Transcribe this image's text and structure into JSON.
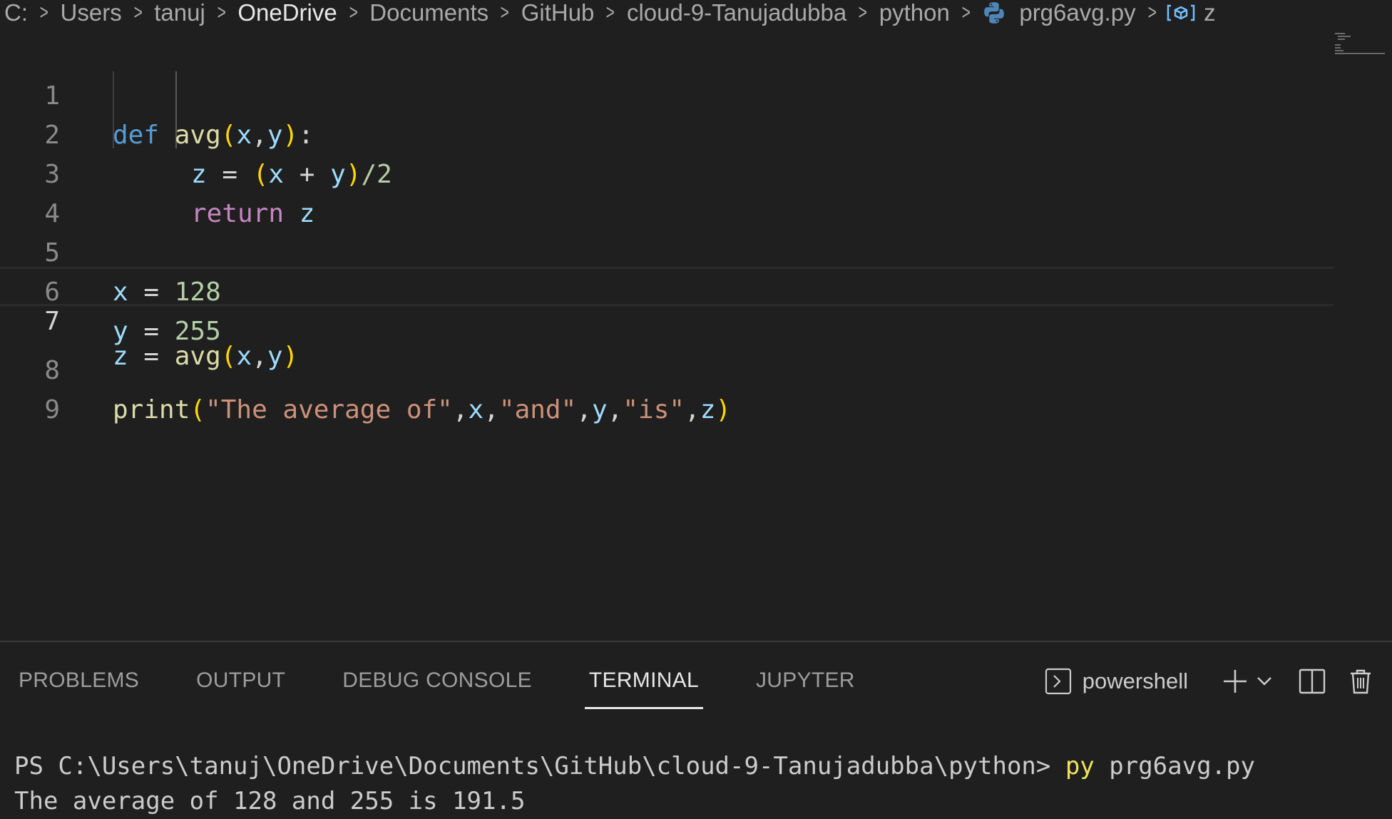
{
  "breadcrumb": {
    "items": [
      "C:",
      "Users",
      "tanuj",
      "OneDrive",
      "Documents",
      "GitHub",
      "cloud-9-Tanujadubba",
      "python",
      "prg6avg.py",
      "z"
    ]
  },
  "editor": {
    "line_numbers": [
      "1",
      "2",
      "3",
      "4",
      "5",
      "6",
      "7",
      "8",
      "9"
    ],
    "active_line": 7,
    "tokens": {
      "l1": [
        "def",
        " ",
        "avg",
        "(",
        "x",
        ",",
        "y",
        ")",
        ":"
      ],
      "l2": [
        "z",
        " = ",
        "(",
        "x",
        " + ",
        "y",
        ")",
        "/2"
      ],
      "l3": [
        "return",
        " ",
        "z"
      ],
      "l5": [
        "x",
        " = ",
        "128"
      ],
      "l6": [
        "y",
        " = ",
        "255"
      ],
      "l7": [
        "z",
        " = ",
        "avg",
        "(",
        "x",
        ",",
        "y",
        ")"
      ],
      "l8": [
        "print",
        "(",
        "\"The average of\"",
        ",",
        "x",
        ",",
        "\"and\"",
        ",",
        "y",
        ",",
        "\"is\"",
        ",",
        "z",
        ")"
      ]
    }
  },
  "panel": {
    "tabs": [
      "PROBLEMS",
      "OUTPUT",
      "DEBUG CONSOLE",
      "TERMINAL",
      "JUPYTER"
    ],
    "active_tab": "TERMINAL",
    "terminal_profile": "powershell",
    "terminal": {
      "prompt": "PS C:\\Users\\tanuj\\OneDrive\\Documents\\GitHub\\cloud-9-Tanujadubba\\python> ",
      "cmd": "py",
      "args": " prg6avg.py",
      "output": "The average of 128 and 255 is 191.5"
    }
  },
  "colors": {
    "background": "#1f1f1f",
    "keyword": "#569cd6",
    "control_keyword": "#c586c0",
    "function": "#dcdcaa",
    "variable": "#9cdcfe",
    "number": "#b5cea8",
    "string": "#ce9178",
    "bracket": "#ffd700"
  }
}
